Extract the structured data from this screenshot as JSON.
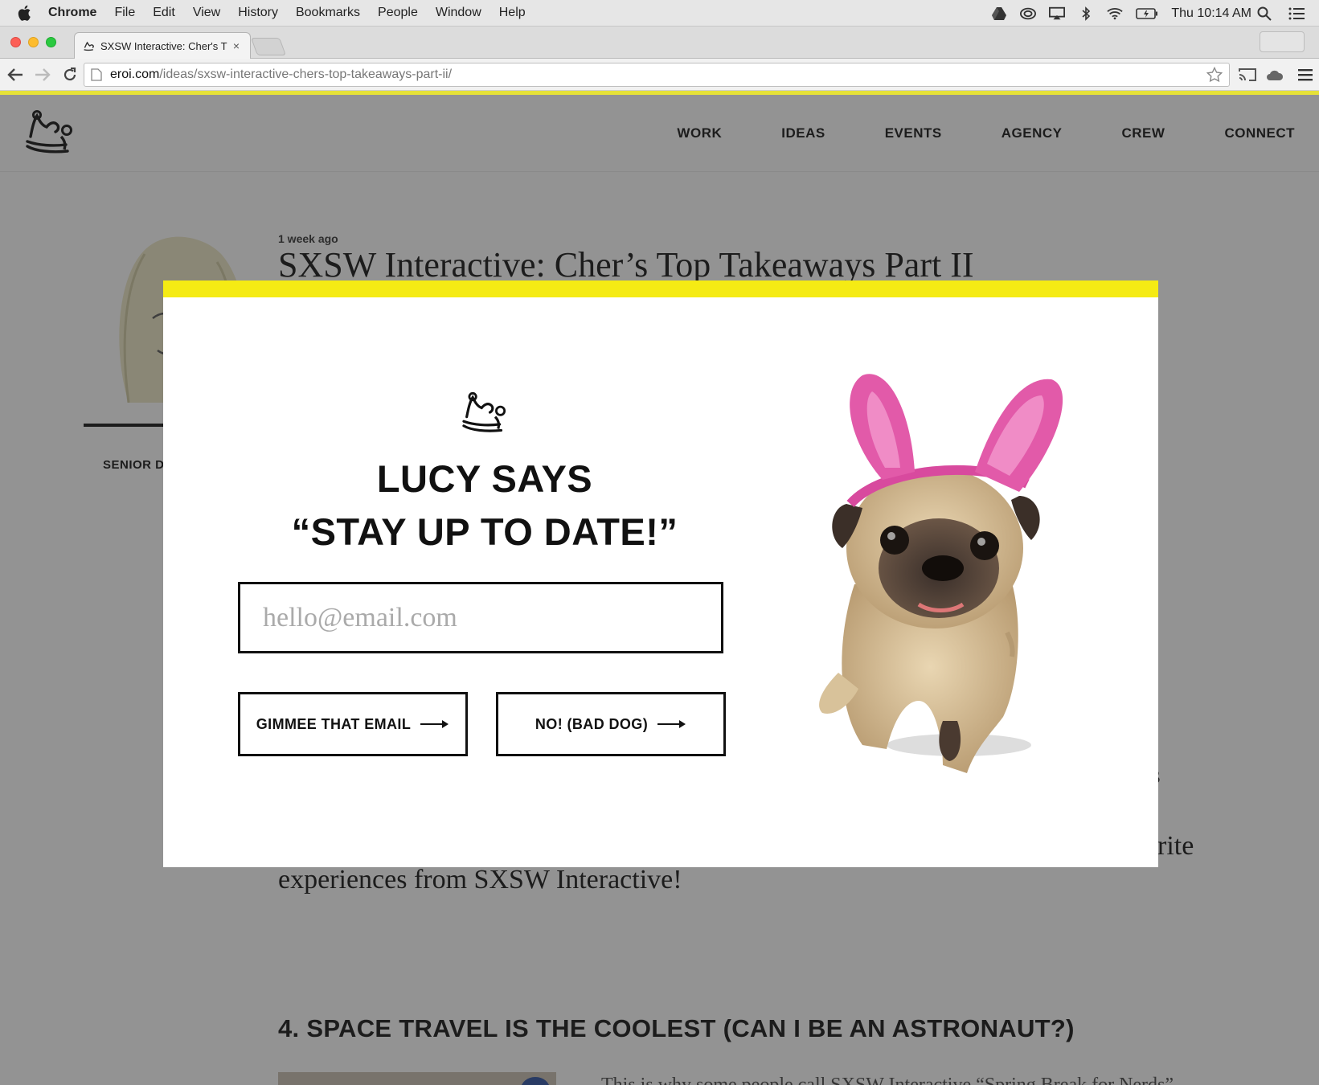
{
  "menubar": {
    "app": "Chrome",
    "items": [
      "File",
      "Edit",
      "View",
      "History",
      "Bookmarks",
      "People",
      "Window",
      "Help"
    ],
    "clock": "Thu 10:14 AM"
  },
  "browser": {
    "tab_title": "SXSW Interactive: Cher's T",
    "url_host": "eroi.com",
    "url_path": "/ideas/sxsw-interactive-chers-top-takeaways-part-ii/"
  },
  "site": {
    "nav": [
      "WORK",
      "IDEAS",
      "EVENTS",
      "AGENCY",
      "CREW",
      "CONNECT"
    ],
    "post_date": "1 week ago",
    "post_title": "SXSW Interactive: Cher’s Top Takeaways Part II",
    "author_role": "SENIOR D",
    "body_fragment_1": "s",
    "body_fragment_2": "rite",
    "body_line": "experiences from SXSW Interactive!",
    "section_heading": "4. SPACE TRAVEL IS THE COOLEST (CAN I BE AN ASTRONAUT?)",
    "body_cut": "This is why some people call SXSW Interactive “Spring Break for Nerds”."
  },
  "modal": {
    "title_line1": "LUCY SAYS",
    "title_line2": "“STAY UP TO DATE!”",
    "email_placeholder": "hello@email.com",
    "primary_button": "GIMMEE THAT EMAIL",
    "secondary_button": "NO! (BAD DOG)",
    "accent_color": "#f5eb14"
  }
}
